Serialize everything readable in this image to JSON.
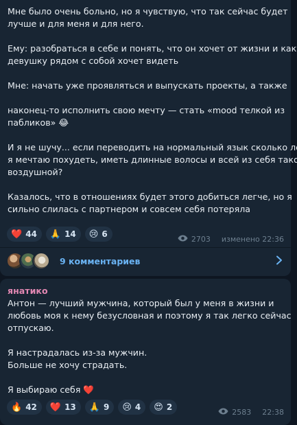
{
  "post": {
    "paragraphs": [
      [
        "Мне было очень больно, но я чувствую, что так сейчас будет",
        "лучше и для меня и для него."
      ],
      [
        "Ему: разобраться в себе и понять, что он хочет от жизни и какую",
        "девушку рядом с собой хочет видеть"
      ],
      [
        "Мне: начать уже проявляться и выпускать проекты, а также"
      ],
      [
        "наконец-то исполнить свою мечту — стать «mood телкой из",
        "пабликов» 😂"
      ],
      [
        "И я не шучу... если переводить на нормальный язык сколько лет",
        "я мечтаю похудеть, иметь длинные волосы и всей из себя такой",
        "воздушной?"
      ],
      [
        "Казалось, что в отношениях будет этого добиться легче, но я",
        "сильно слилась с партнером и совсем себя потеряла"
      ]
    ],
    "reactions": [
      {
        "emoji": "❤️",
        "count": "44"
      },
      {
        "emoji": "🙏",
        "count": "14"
      },
      {
        "emoji": "😢",
        "count": "6"
      }
    ],
    "views": "2703",
    "time": "изменено 22:36",
    "comments_label": "9 комментариев"
  },
  "comment": {
    "author": "янатико",
    "paragraphs": [
      [
        "Антон — лучший мужчина, который был у меня в жизни и",
        "любовь моя к нему безусловная и поэтому я так легко сейчас",
        "отпускаю."
      ],
      [
        "Я настрадалась из-за мужчин.",
        "Больше не хочу страдать."
      ],
      [
        "Я выбираю себя ❤️"
      ]
    ],
    "reactions": [
      {
        "emoji": "🔥",
        "count": "42"
      },
      {
        "emoji": "❤️",
        "count": "13"
      },
      {
        "emoji": "🙏",
        "count": "9"
      },
      {
        "emoji": "😢",
        "count": "4"
      },
      {
        "emoji": "😍",
        "count": "2"
      }
    ],
    "views": "2583",
    "time": "22:38"
  },
  "colors": {
    "background": "#0e1621",
    "bubble": "#182533",
    "link": "#6ab3f3",
    "author": "#e388b3",
    "meta": "#6d7f8f"
  }
}
